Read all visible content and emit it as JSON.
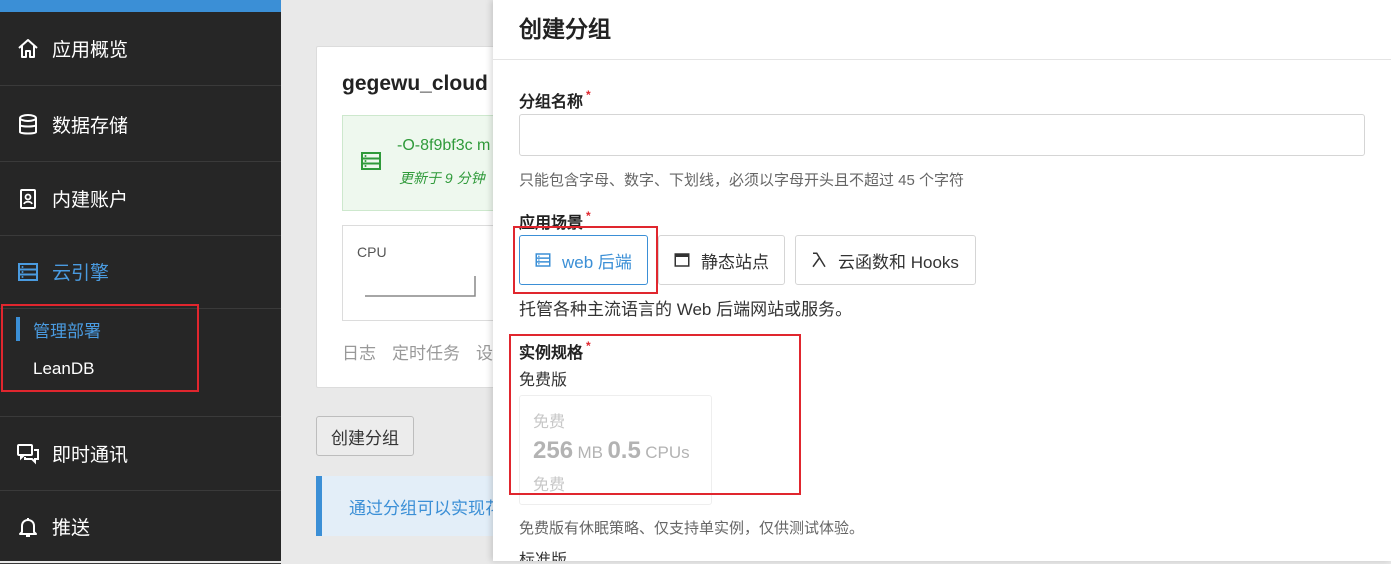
{
  "sidebar": {
    "items": [
      {
        "label": "应用概览",
        "icon": "home-icon"
      },
      {
        "label": "数据存储",
        "icon": "database-icon"
      },
      {
        "label": "内建账户",
        "icon": "user-card-icon"
      },
      {
        "label": "云引擎",
        "icon": "server-icon"
      }
    ],
    "sub_items": [
      {
        "label": "管理部署",
        "active": true
      },
      {
        "label": "LeanDB",
        "active": false
      }
    ],
    "bottom_items": [
      {
        "label": "即时通讯",
        "icon": "chat-icon"
      },
      {
        "label": "推送",
        "icon": "bell-icon"
      }
    ]
  },
  "main": {
    "card_title": "gegewu_cloud",
    "group_id": "-O-8f9bf3c m",
    "updated": "更新于 9 分钟",
    "cpu_label": "CPU",
    "tabs": [
      "日志",
      "定时任务",
      "设"
    ],
    "create_button": "创建分组",
    "info_text": "通过分组可以实现花"
  },
  "drawer": {
    "title": "创建分组",
    "name_label": "分组名称",
    "name_value": "",
    "name_hint": "只能包含字母、数字、下划线，必须以字母开头且不超过 45 个字符",
    "scene_label": "应用场景",
    "scenes": [
      {
        "label": "web 后端",
        "icon": "server-icon",
        "selected": true
      },
      {
        "label": "静态站点",
        "icon": "browser-window-icon",
        "selected": false
      },
      {
        "label": "云函数和 Hooks",
        "icon": "lambda-icon",
        "selected": false
      }
    ],
    "scene_desc": "托管各种主流语言的 Web 后端网站或服务。",
    "spec_label": "实例规格",
    "free_label": "免费版",
    "plan": {
      "top": "免费",
      "mem_value": "256",
      "mem_unit": "MB",
      "cpu_value": "0.5",
      "cpu_unit": "CPUs",
      "bottom": "免费"
    },
    "plan_note": "免费版有休眠策略、仅支持单实例，仅供测试体验。",
    "standard_label": "标准版",
    "required_mark": "*"
  },
  "colors": {
    "accent": "#3b8fd6",
    "sidebar_bg": "#262626",
    "highlight_red": "#e0262e",
    "success_green": "#2f9a3a"
  }
}
